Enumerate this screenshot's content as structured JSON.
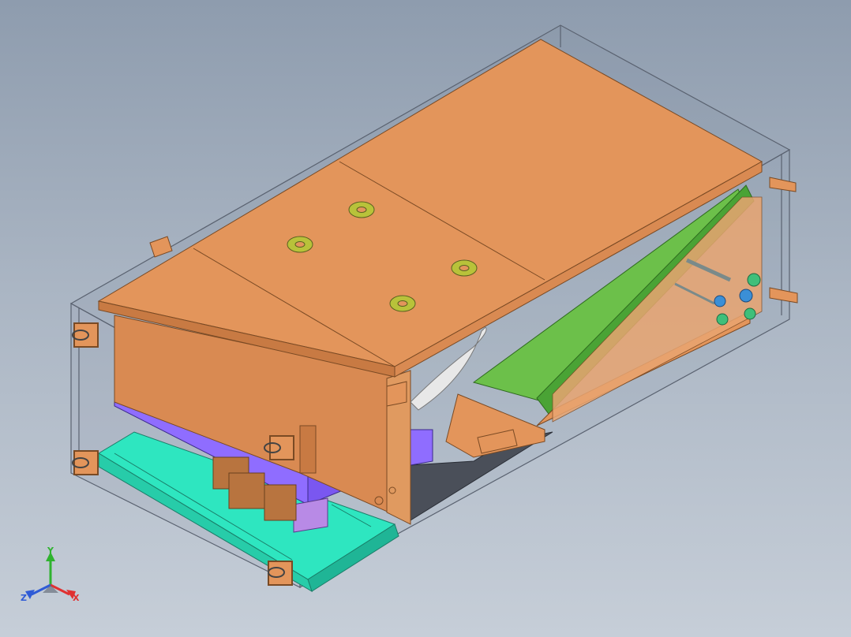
{
  "viewport": {
    "background_top": "#8e9cae",
    "background_bottom": "#c6ced8"
  },
  "model": {
    "colors": {
      "copper": "#e3955b",
      "copper_dark": "#c87a43",
      "copper_side": "#d98a52",
      "green_filter": "#6cc04a",
      "green_dark": "#3f8f2a",
      "purple_plate": "#8f6dff",
      "purple_block": "#b88ae6",
      "teal_tray": "#2ee6c0",
      "teal_dark": "#1fb596",
      "frame_line": "#5a6270",
      "fan_ring": "#e8e8e8",
      "washer": "#b8c23a",
      "pipe_blue": "#3b8fd6",
      "pipe_green": "#3fbf7a"
    },
    "icons": [
      "lifting-eye-icon",
      "mounting-bracket-icon",
      "mounting-nut-icon"
    ]
  },
  "triad": {
    "x_label": "X",
    "y_label": "Y",
    "z_label": "Z",
    "x_color": "#e03131",
    "y_color": "#2fb32f",
    "z_color": "#2f5bd6"
  }
}
